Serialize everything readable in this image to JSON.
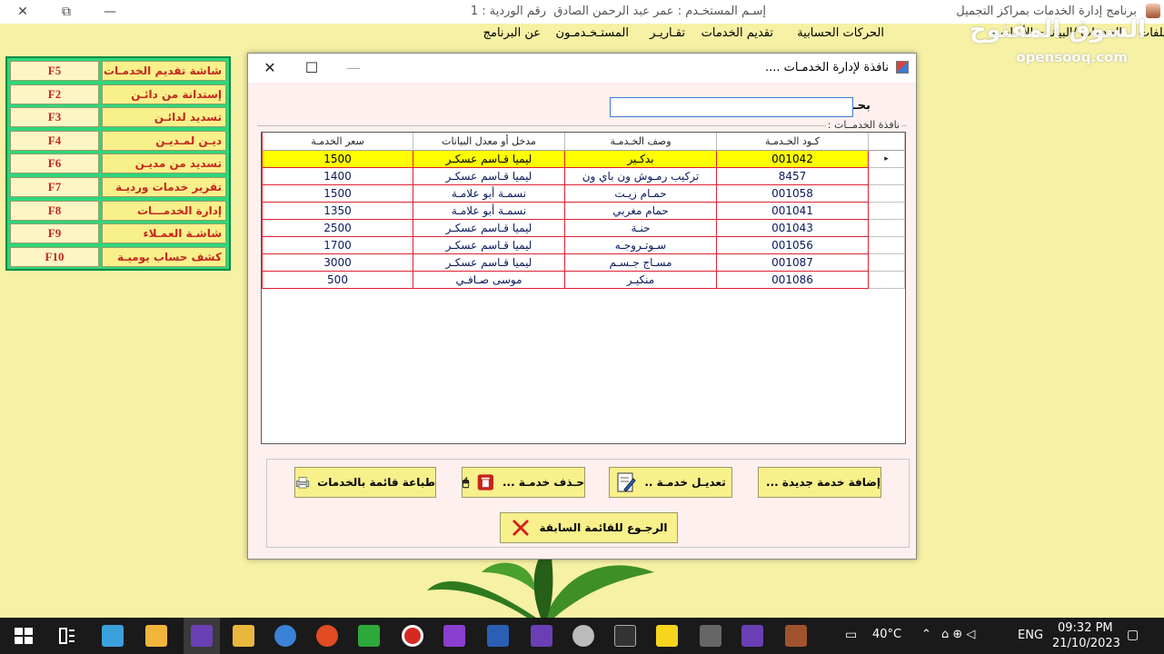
{
  "app": {
    "title": "برنامج إدارة الخدمات بمراكز التجميل",
    "user": "إسـم المستخـدم : عمر عبد الرحمن الصادق",
    "shift": "رقم الوردية : 1",
    "min": "—",
    "restore": "⧉",
    "close": "✕"
  },
  "menu": {
    "items": [
      "ملفات",
      "الخدمات /البيانات الأساسية",
      "الحركات الحسابية",
      "تقديم الخدمات",
      "تقـاريـر",
      "المستـخـدمـون",
      "عن البرنامج"
    ]
  },
  "watermark": {
    "main": "السوق المفتوح",
    "sub": "opensooq.com"
  },
  "shortcuts": [
    {
      "label": "شاشة تقديم الخدمـات",
      "key": "F5"
    },
    {
      "label": "إستدانة من دائـن",
      "key": "F2"
    },
    {
      "label": "تسديد لدائـن",
      "key": "F3"
    },
    {
      "label": "ديـن لمـديـن",
      "key": "F4"
    },
    {
      "label": "تسديد من مديـن",
      "key": "F6"
    },
    {
      "label": "تقرير خدمات ورديـة",
      "key": "F7"
    },
    {
      "label": "إدارة الخدمـــات",
      "key": "F8"
    },
    {
      "label": "شاشـة العمـلاء",
      "key": "F9"
    },
    {
      "label": "كشف حساب يوميـة",
      "key": "F10"
    }
  ],
  "dialog": {
    "title": "نافذة لإدارة الخدمـات ....",
    "min": "—",
    "max": "☐",
    "close": "✕",
    "search_label": "بحـث :",
    "search_value": "",
    "group_label": "نافذة الخدمــات :",
    "columns": {
      "code": "كـود الخـدمـة",
      "desc": "وصف الخـدمـة",
      "employee": "مدخل أو معدل البيانات",
      "price": "سعر الخدمـة"
    },
    "rows": [
      {
        "code": "001042",
        "desc": "بدكـير",
        "employee": "ليميا قـاسم عسكـر",
        "price": "1500",
        "selected": true
      },
      {
        "code": "8457",
        "desc": "تركيب رمـوش ون باي ون",
        "employee": "ليميا قـاسم عسكـر",
        "price": "1400"
      },
      {
        "code": "001058",
        "desc": "حمـام زيـت",
        "employee": "نسمـة أبو علامـة",
        "price": "1500"
      },
      {
        "code": "001041",
        "desc": "حمام مغربي",
        "employee": "نسمـة أبو علامـة",
        "price": "1350"
      },
      {
        "code": "001043",
        "desc": "حنـة",
        "employee": "ليميا قـاسم عسكـر",
        "price": "2500"
      },
      {
        "code": "001056",
        "desc": "سـوتـروجـه",
        "employee": "ليميا قـاسم عسكـر",
        "price": "1700"
      },
      {
        "code": "001087",
        "desc": "مسـاج جـسـم",
        "employee": "ليميا قـاسم عسكـر",
        "price": "3000"
      },
      {
        "code": "001086",
        "desc": "منكيـر",
        "employee": "موسى صـافـي",
        "price": "500"
      }
    ],
    "buttons": {
      "add": "إضافة خدمة جديدة ...",
      "edit": "تعديـل خدمـة ..",
      "delete": "حـذف خدمـة ...",
      "print": "طباعة قائمة بالخدمات",
      "back": "الرجـوع للقائمة السابقة"
    }
  },
  "taskbar": {
    "temperature": "40°C",
    "language": "ENG",
    "time": "09:32 PM",
    "date": "21/10/2023"
  }
}
